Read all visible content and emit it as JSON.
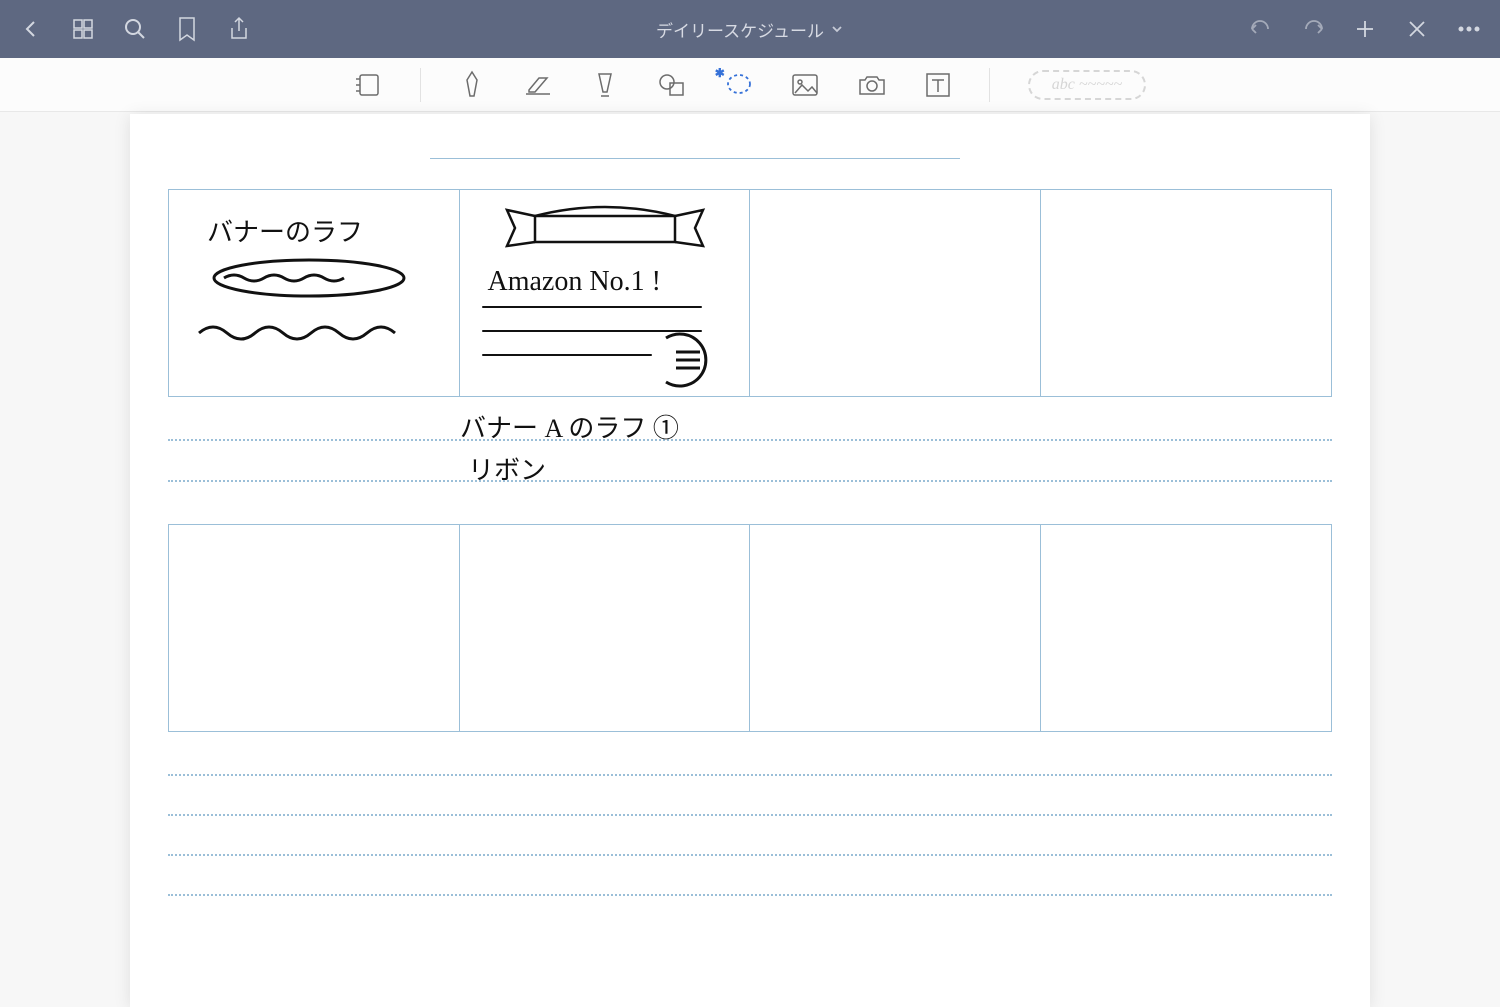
{
  "header": {
    "title": "デイリースケジュール"
  },
  "toolbar": {
    "placeholder_hint": "abc ~~~~~"
  },
  "page": {
    "annotations": {
      "cell1_title": "バナーのラフ",
      "cell2_text": "Amazon No.1 !",
      "caption_line1": "バナー A のラフ ①",
      "caption_line2": "リボン"
    }
  }
}
